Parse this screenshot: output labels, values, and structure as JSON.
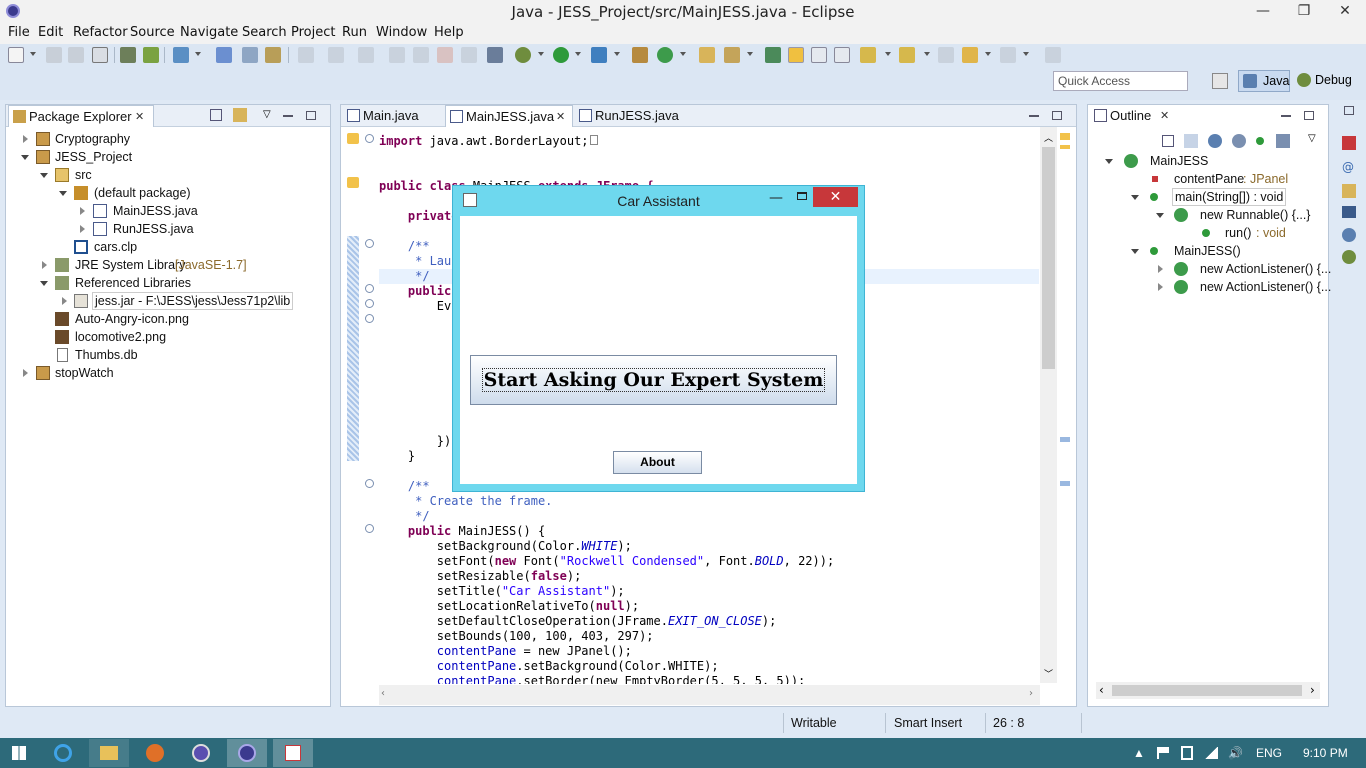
{
  "window": {
    "title": "Java - JESS_Project/src/MainJESS.java - Eclipse",
    "minimize": "—",
    "maximize": "❐",
    "close": "✕"
  },
  "menu": [
    "File",
    "Edit",
    "Refactor",
    "Source",
    "Navigate",
    "Search",
    "Project",
    "Run",
    "Window",
    "Help"
  ],
  "quick_access": {
    "placeholder": "Quick Access"
  },
  "perspectives": {
    "java": "Java",
    "debug": "Debug"
  },
  "package_explorer": {
    "title": "Package Explorer",
    "items": [
      {
        "label": "Cryptography"
      },
      {
        "label": "JESS_Project"
      },
      {
        "label": "src"
      },
      {
        "label": "(default package)"
      },
      {
        "label": "MainJESS.java"
      },
      {
        "label": "RunJESS.java"
      },
      {
        "label": "cars.clp"
      },
      {
        "label": "JRE System Library",
        "suffix": "[JavaSE-1.7]"
      },
      {
        "label": "Referenced Libraries"
      },
      {
        "label": "jess.jar - F:\\JESS\\jess\\Jess71p2\\lib"
      },
      {
        "label": "Auto-Angry-icon.png"
      },
      {
        "label": "locomotive2.png"
      },
      {
        "label": "Thumbs.db"
      },
      {
        "label": "stopWatch"
      }
    ]
  },
  "editor": {
    "tabs": [
      "Main.java",
      "MainJESS.java",
      "RunJESS.java"
    ],
    "code": [
      {
        "a": "import",
        "b": " java.awt.BorderLayout;",
        "c": ""
      },
      {
        "a": "",
        "b": "",
        "c": ""
      },
      {
        "a": "public class",
        "b": " MainJESS ",
        "c": "extends JFrame {"
      },
      {
        "a": "",
        "b": "",
        "c": ""
      },
      {
        "a": "    private",
        "b": "",
        "c": ""
      },
      {
        "a": "",
        "b": "",
        "c": ""
      },
      {
        "a": "    /**",
        "b": "",
        "c": ""
      },
      {
        "a": "     * Laun",
        "b": "",
        "c": ""
      },
      {
        "a": "     */",
        "b": "",
        "c": ""
      },
      {
        "a": "    public",
        "b": "",
        "c": ""
      },
      {
        "a": "        Eve",
        "b": "",
        "c": ""
      },
      {
        "a": "        });",
        "b": "",
        "c": ""
      },
      {
        "a": "    }",
        "b": "",
        "c": ""
      },
      {
        "a": "    /**",
        "b": "",
        "c": ""
      },
      {
        "a": "     * Create the frame.",
        "b": "",
        "c": ""
      },
      {
        "a": "     */",
        "b": "",
        "c": ""
      },
      {
        "a": "    public",
        "b": " MainJESS() {",
        "c": ""
      },
      {
        "a": "        setBackground(Color.",
        "b": "WHITE",
        "c": ");"
      },
      {
        "a": "        setFont(",
        "b": "new",
        "c": " Font("
      },
      {
        "a": "        setResizable(",
        "b": "false",
        "c": ");"
      },
      {
        "a": "        setTitle(",
        "b": "\"Car Assistant\"",
        "c": ");"
      },
      {
        "a": "        setLocationRelativeTo(",
        "b": "null",
        "c": ");"
      },
      {
        "a": "        setDefaultCloseOperation(JFrame.",
        "b": "EXIT_ON_CLOSE",
        "c": ");"
      },
      {
        "a": "        setBounds(100, 100, 403, 297);",
        "b": "",
        "c": ""
      },
      {
        "a": "        ",
        "b": "contentPane",
        "c": " = new JPanel();"
      },
      {
        "a": "        ",
        "b": "contentPane",
        "c": ".setBackground(Color.WHITE);"
      },
      {
        "a": "        ",
        "b": "contentPane",
        "c": ".setBorder(new EmptyBorder(5, 5, 5, 5));"
      }
    ],
    "setfont_rest": {
      "str": "\"Rockwell Condensed\"",
      "mid": ", Font.",
      "bold": "BOLD",
      "end": ", 22));"
    }
  },
  "outline": {
    "title": "Outline",
    "items": [
      {
        "label": "MainJESS"
      },
      {
        "label": "contentPane",
        "type": " : JPanel"
      },
      {
        "label": "main(String[]) : void"
      },
      {
        "label": "new Runnable() {...}"
      },
      {
        "label": "run()",
        "type": " : void"
      },
      {
        "label": "MainJESS()"
      },
      {
        "label": "new ActionListener() {..."
      },
      {
        "label": "new ActionListener() {..."
      }
    ]
  },
  "dialog": {
    "title": "Car Assistant",
    "big_button": "Start Asking Our Expert System",
    "about_button": "About",
    "close": "✕",
    "minimize": "—"
  },
  "status": {
    "writable": "Writable",
    "insert": "Smart Insert",
    "position": "26 : 8"
  },
  "taskbar": {
    "lang": "ENG",
    "time": "9:10 PM"
  },
  "colors": {
    "accent": "#2d6a7a",
    "dialog_frame": "#6ed8ee",
    "close_red": "#c7373a"
  }
}
